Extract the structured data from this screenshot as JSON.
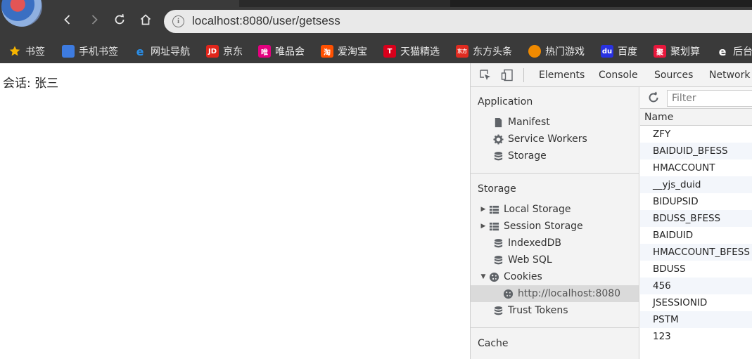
{
  "browser": {
    "url": "localhost:8080/user/getsess",
    "bookmarks": [
      {
        "label": "书签",
        "icon": "star-icon",
        "color": "#f5b400"
      },
      {
        "label": "手机书签",
        "icon": "phone-bookmark-icon",
        "color": "#3d7be0"
      },
      {
        "label": "网址导航",
        "icon": "ie-logo-icon",
        "color": "#2a8ee8"
      },
      {
        "label": "京东",
        "icon": "jd-logo-icon",
        "color": "#e1251b",
        "glyph": "JD"
      },
      {
        "label": "唯品会",
        "icon": "vip-logo-icon",
        "color": "#e4007f",
        "glyph": "唯"
      },
      {
        "label": "爱淘宝",
        "icon": "taobao-logo-icon",
        "color": "#ff5000",
        "glyph": "淘"
      },
      {
        "label": "天猫精选",
        "icon": "tmall-logo-icon",
        "color": "#d9001b",
        "glyph": "T"
      },
      {
        "label": "东方头条",
        "icon": "dftoutiao-logo-icon",
        "color": "#e02b20",
        "glyph": "东方"
      },
      {
        "label": "热门游戏",
        "icon": "game-logo-icon",
        "color": "#f08a00"
      },
      {
        "label": "百度",
        "icon": "baidu-logo-icon",
        "color": "#2932e1"
      },
      {
        "label": "聚划算",
        "icon": "juhuasuan-logo-icon",
        "color": "#e8173c",
        "glyph": "聚"
      },
      {
        "label": "后台",
        "icon": "ie-logo-icon",
        "color": "#ffffff"
      }
    ]
  },
  "page": {
    "session_text": "会话: 张三"
  },
  "devtools": {
    "tabs": [
      "Elements",
      "Console",
      "Sources",
      "Network"
    ],
    "sidebar": {
      "application_title": "Application",
      "application_items": [
        "Manifest",
        "Service Workers",
        "Storage"
      ],
      "storage_title": "Storage",
      "storage_items": [
        "Local Storage",
        "Session Storage",
        "IndexedDB",
        "Web SQL",
        "Cookies"
      ],
      "cookie_origin": "http://localhost:8080",
      "trust_tokens": "Trust Tokens",
      "cache_title": "Cache"
    },
    "filter_placeholder": "Filter",
    "column_name": "Name",
    "cookies": [
      "ZFY",
      "BAIDUID_BFESS",
      "HMACCOUNT",
      "__yjs_duid",
      "BIDUPSID",
      "BDUSS_BFESS",
      "BAIDUID",
      "HMACCOUNT_BFESS",
      "BDUSS",
      "456",
      "JSESSIONID",
      "PSTM",
      "123"
    ]
  }
}
